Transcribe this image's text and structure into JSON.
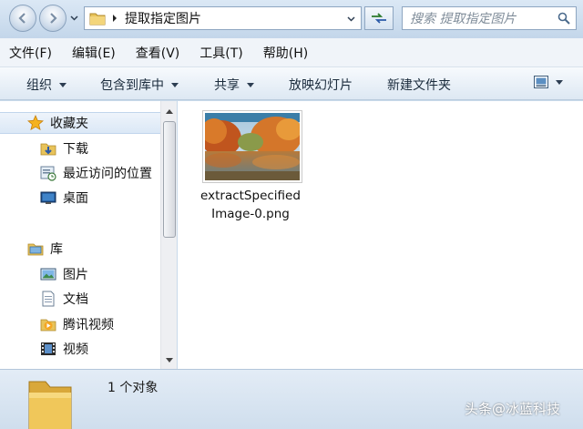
{
  "address": {
    "path": "提取指定图片",
    "folder_icon": "folder-icon"
  },
  "search": {
    "placeholder": "搜索 提取指定图片"
  },
  "menu": {
    "items": [
      "文件(F)",
      "编辑(E)",
      "查看(V)",
      "工具(T)",
      "帮助(H)"
    ]
  },
  "toolbar": {
    "organize": "组织",
    "include_library": "包含到库中",
    "share": "共享",
    "slideshow": "放映幻灯片",
    "new_folder": "新建文件夹"
  },
  "sidebar": {
    "favorites": "收藏夹",
    "downloads": "下载",
    "recent": "最近访问的位置",
    "desktop": "桌面",
    "libraries": "库",
    "pictures": "图片",
    "documents": "文档",
    "tencent_video": "腾讯视频",
    "videos": "视频"
  },
  "files": [
    {
      "name": "extractSpecifiedImage-0.png",
      "line1": "extractSpecified",
      "line2": "Image-0.png"
    }
  ],
  "status": {
    "count": "1 个对象"
  },
  "watermark": "头条@冰蓝科技",
  "colors": {
    "accent": "#3a6ea5",
    "chrome": "#c9daea"
  }
}
